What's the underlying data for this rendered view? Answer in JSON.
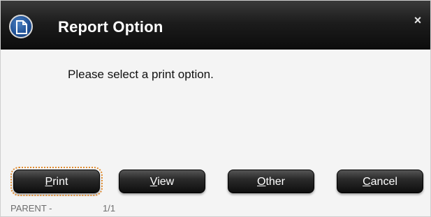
{
  "dialog": {
    "title": "Report Option",
    "close_glyph": "×",
    "message": "Please select a print option."
  },
  "buttons": {
    "print": {
      "label": "Print",
      "mnemonic": "P",
      "rest": "rint"
    },
    "view": {
      "label": "View",
      "mnemonic": "V",
      "rest": "iew"
    },
    "other": {
      "label": "Other",
      "mnemonic": "O",
      "rest": "ther"
    },
    "cancel": {
      "label": "Cancel",
      "mnemonic": "C",
      "rest": "ancel"
    }
  },
  "status": {
    "context": "PARENT -",
    "page": "1/1"
  },
  "icons": {
    "title_icon": "document-icon",
    "close_icon": "close-icon"
  },
  "colors": {
    "titlebar": "#111111",
    "title_text": "#ffffff",
    "button_bg": "#1a1a1a",
    "focus_outline": "#e08a2c",
    "icon_blue": "#1f4f93"
  }
}
